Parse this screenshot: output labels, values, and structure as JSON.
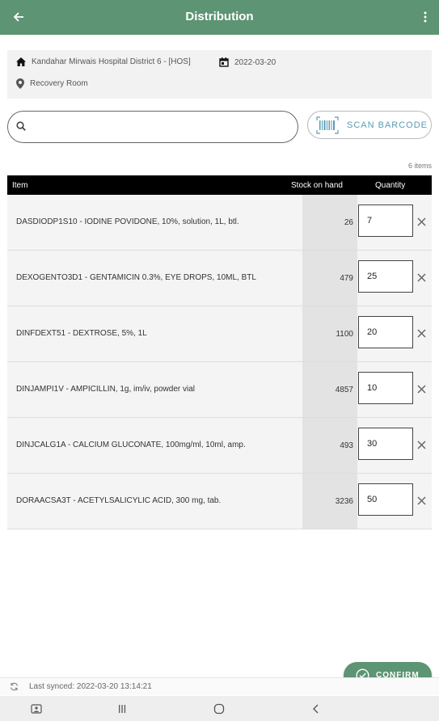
{
  "header": {
    "title": "Distribution",
    "back_icon": "arrow-left-icon",
    "menu_icon": "more-vertical-icon"
  },
  "info": {
    "facility": "Kandahar Mirwais Hospital District 6 - [HOS]",
    "date": "2022-03-20",
    "location": "Recovery Room"
  },
  "search": {
    "placeholder": "",
    "value": ""
  },
  "scan": {
    "label": "SCAN BARCODE"
  },
  "item_count": "6 items",
  "table": {
    "headers": {
      "item": "Item",
      "stock": "Stock on hand",
      "quantity": "Quantity"
    },
    "rows": [
      {
        "item": "DASDIODP1S10 - IODINE POVIDONE, 10%, solution, 1L, btl.",
        "stock": "26",
        "qty": "7"
      },
      {
        "item": "DEXOGENTO3D1 - GENTAMICIN 0.3%, EYE DROPS, 10ML, BTL",
        "stock": "479",
        "qty": "25"
      },
      {
        "item": "DINFDEXT51 - DEXTROSE, 5%, 1L",
        "stock": "1100",
        "qty": "20"
      },
      {
        "item": "DINJAMPI1V - AMPICILLIN, 1g, im/iv, powder vial",
        "stock": "4857",
        "qty": "10"
      },
      {
        "item": "DINJCALG1A - CALCIUM GLUCONATE, 100mg/ml, 10ml, amp.",
        "stock": "493",
        "qty": "30"
      },
      {
        "item": "DORAACSA3T - ACETYLSALICYLIC ACID, 300 mg, tab.",
        "stock": "3236",
        "qty": "50"
      }
    ]
  },
  "confirm": {
    "label": "CONFIRM"
  },
  "sync": {
    "text": "Last synced:  2022-03-20 13:14:21"
  },
  "colors": {
    "primary": "#5d9473",
    "accent": "#5a9cb3"
  }
}
